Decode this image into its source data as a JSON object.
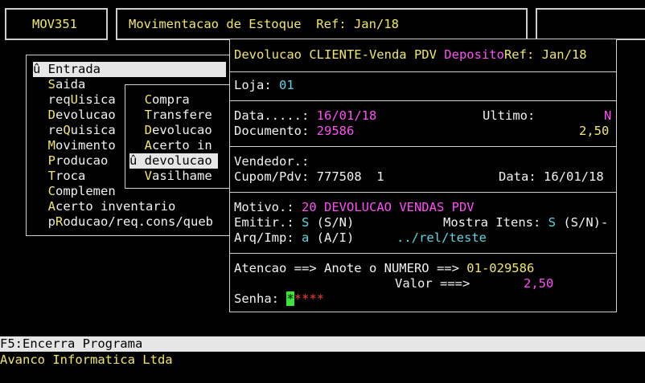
{
  "header": {
    "program_code": "MOV351",
    "title": "Movimentacao de Estoque  Ref: Jan/18"
  },
  "main_menu": {
    "items": [
      {
        "pre": "û ",
        "hot": "E",
        "post": "ntrada",
        "selected": true
      },
      {
        "pre": "  ",
        "hot": "S",
        "post": "aida"
      },
      {
        "pre": "  req",
        "hot": "U",
        "post": "isica"
      },
      {
        "pre": "  ",
        "hot": "D",
        "post": "evolucao"
      },
      {
        "pre": "  re",
        "hot": "Q",
        "post": "uisica"
      },
      {
        "pre": "  ",
        "hot": "M",
        "post": "ovimento"
      },
      {
        "pre": "  ",
        "hot": "P",
        "post": "roducao"
      },
      {
        "pre": "  ",
        "hot": "T",
        "post": "roca"
      },
      {
        "pre": "  ",
        "hot": "C",
        "post": "omplemen"
      },
      {
        "pre": "  ",
        "hot": "A",
        "post": "certo inventario"
      },
      {
        "pre": "  p",
        "hot": "R",
        "post": "oducao/req.cons/queb"
      }
    ]
  },
  "submenu": {
    "items": [
      {
        "pre": "  ",
        "hot": "C",
        "post": "ompra"
      },
      {
        "pre": "  ",
        "hot": "T",
        "post": "ransfere"
      },
      {
        "pre": "  ",
        "hot": "D",
        "post": "evolucao"
      },
      {
        "pre": "  ",
        "hot": "A",
        "post": "certo in"
      },
      {
        "pre": "û ",
        "hot": "d",
        "post": "evolucao",
        "selected": true
      },
      {
        "pre": "  ",
        "hot": "V",
        "post": "asilhame"
      }
    ]
  },
  "dialog": {
    "title_left": "Devolucao CLIENTE-Venda PDV ",
    "title_deposito": "Deposito",
    "title_ref": "Ref: Jan/18",
    "loja_label": "Loja: ",
    "loja_value": "01",
    "data_label": "Data.....: ",
    "data_value": "16/01/18",
    "ultimo_label": "Ultimo:",
    "ultimo_value": "N",
    "documento_label": "Documento: ",
    "documento_value": "29586",
    "documento_amount": "2,50",
    "vendedor_label": "Vendedor.:",
    "cupom_label": "Cupom/Pdv: ",
    "cupom_value": "777508  1",
    "cupom_data_label": "Data: ",
    "cupom_data_value": "16/01/18",
    "motivo_label": "Motivo.: ",
    "motivo_value": "20 DEVOLUCAO VENDAS PDV",
    "emitir_label": "Emitir.: ",
    "emitir_value": "S",
    "emitir_opts": " (S/N)",
    "mostra_label": "Mostra Itens: ",
    "mostra_value": "S",
    "mostra_opts": " (S/N)-",
    "arq_label": "Arq/Imp: ",
    "arq_value": "a",
    "arq_opts": " (A/I)",
    "arq_path": "../rel/teste",
    "atencao_text": "Atencao ==> Anote o NUMERO ==> ",
    "atencao_number": "01-029586",
    "valor_label": "Valor ===>",
    "valor_value": "2,50",
    "senha_label": "Senha: ",
    "senha_cursor": "*",
    "senha_mask": "****"
  },
  "footer": {
    "key_hint": "F5:Encerra Programa",
    "company": "Avanco Informatica Ltda"
  },
  "colors": {
    "background": "#000000",
    "label": "#f0e76a",
    "value_magenta": "#ff4ff5",
    "value_cyan": "#5ad7e3",
    "highlight_bar": "#e6e6e6",
    "cursor": "#3be33b"
  }
}
